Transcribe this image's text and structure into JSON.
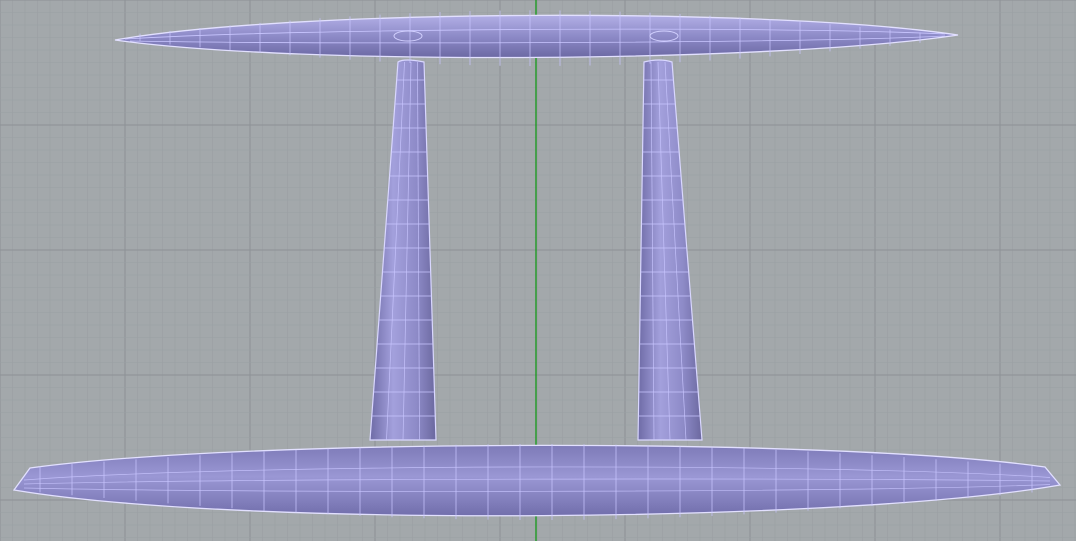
{
  "viewport": {
    "projection": "perspective",
    "display_mode": "shaded-wireframe",
    "view": "front"
  },
  "colors": {
    "background": "#a3a8ab",
    "grid_minor": "#9a9fa3",
    "grid_major": "#8c9196",
    "axis_vertical": "#1f9a24",
    "surface_fill": "#8c89c4",
    "surface_shadow": "#6f6ca8",
    "isocurve": "#c9c6ff",
    "edge": "#e6e4ff"
  },
  "objects": [
    {
      "name": "upper-wing-surface",
      "kind": "hydrofoil"
    },
    {
      "name": "left-strut",
      "kind": "strut"
    },
    {
      "name": "right-strut",
      "kind": "strut"
    },
    {
      "name": "lower-hull",
      "kind": "hull"
    }
  ]
}
